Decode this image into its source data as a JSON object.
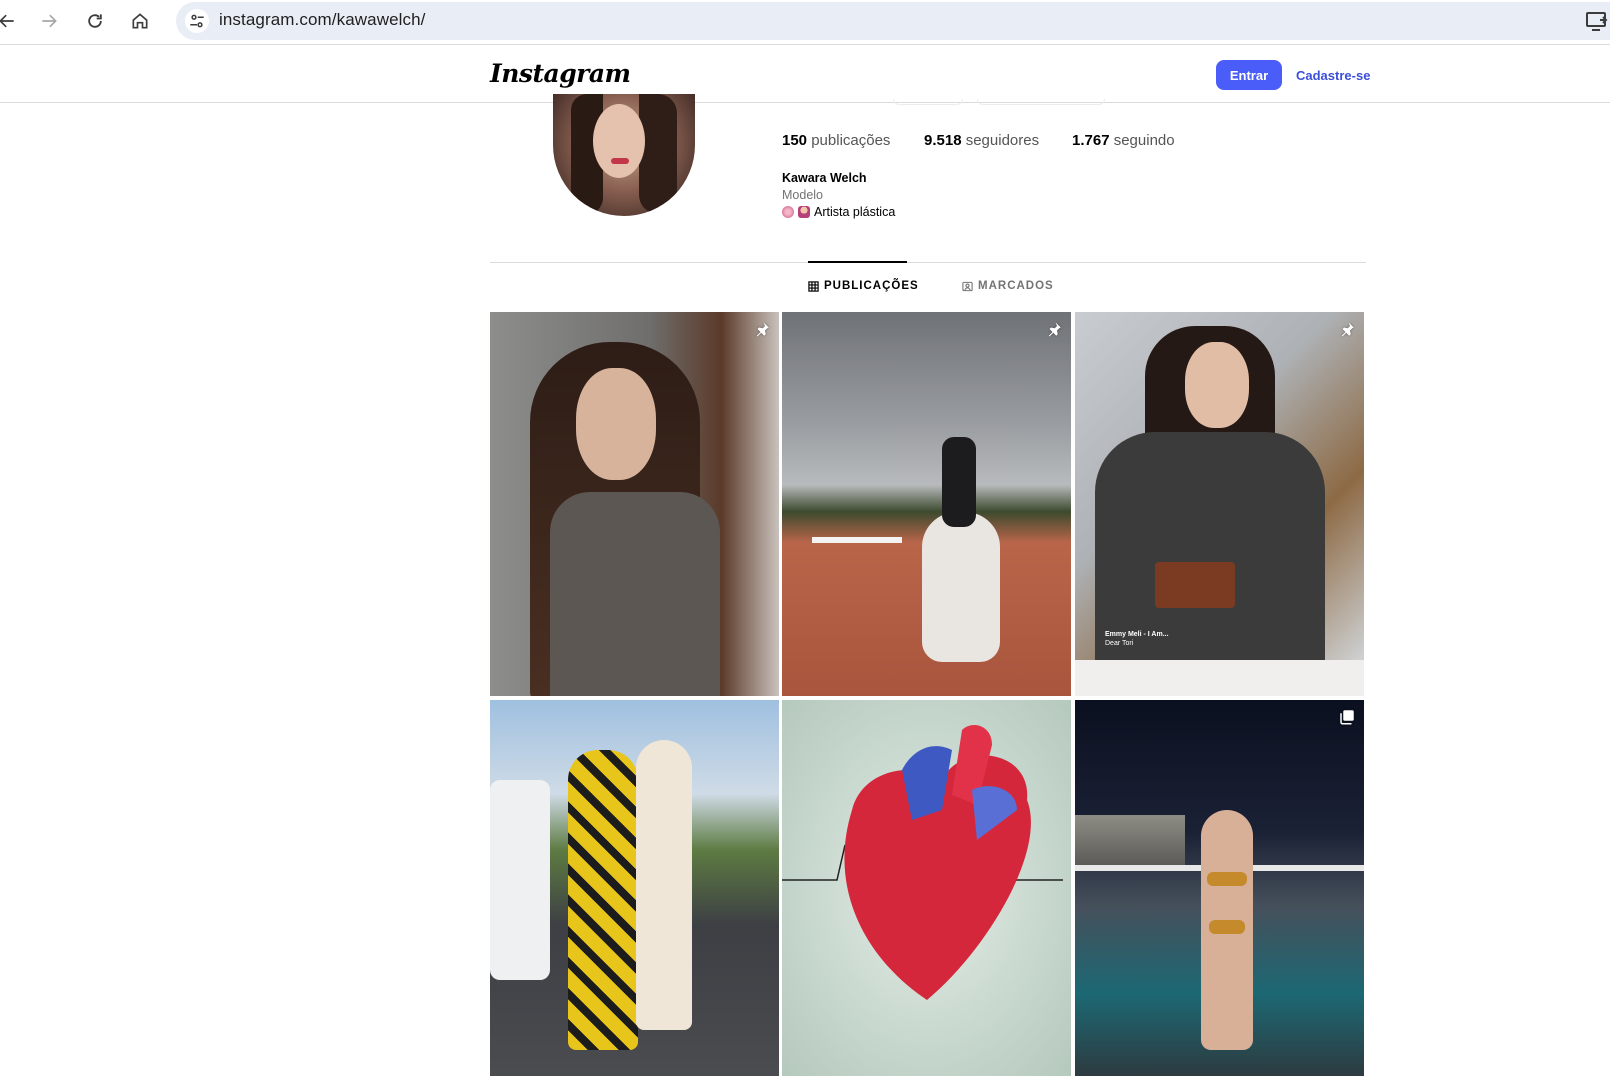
{
  "browser": {
    "url": "instagram.com/kawawelch/"
  },
  "header": {
    "logo": "Instagram",
    "login_label": "Entrar",
    "signup_label": "Cadastre-se"
  },
  "profile": {
    "posts_count": "150",
    "posts_label": "publicações",
    "followers_count": "9.518",
    "followers_label": "seguidores",
    "following_count": "1.767",
    "following_label": "seguindo",
    "name": "Kawara Welch",
    "category": "Modelo",
    "bio": "Artista plástica"
  },
  "tabs": [
    {
      "label": "PUBLICAÇÕES",
      "icon": "grid-icon",
      "active": true
    },
    {
      "label": "MARCADOS",
      "icon": "tagged-icon",
      "active": false
    }
  ],
  "posts": [
    {
      "description": "portrait-woman-mirror",
      "badge": "pin-icon"
    },
    {
      "description": "horse-rider-arena",
      "badge": "pin-icon"
    },
    {
      "description": "woman-wine-glass",
      "badge": "pin-icon",
      "caption_title": "Emmy Meli - I Am...",
      "caption_sub": "Dear Tori"
    },
    {
      "description": "two-women-street",
      "badge": ""
    },
    {
      "description": "painted-heart",
      "badge": ""
    },
    {
      "description": "woman-balcony-night",
      "badge": "carousel-icon"
    }
  ]
}
